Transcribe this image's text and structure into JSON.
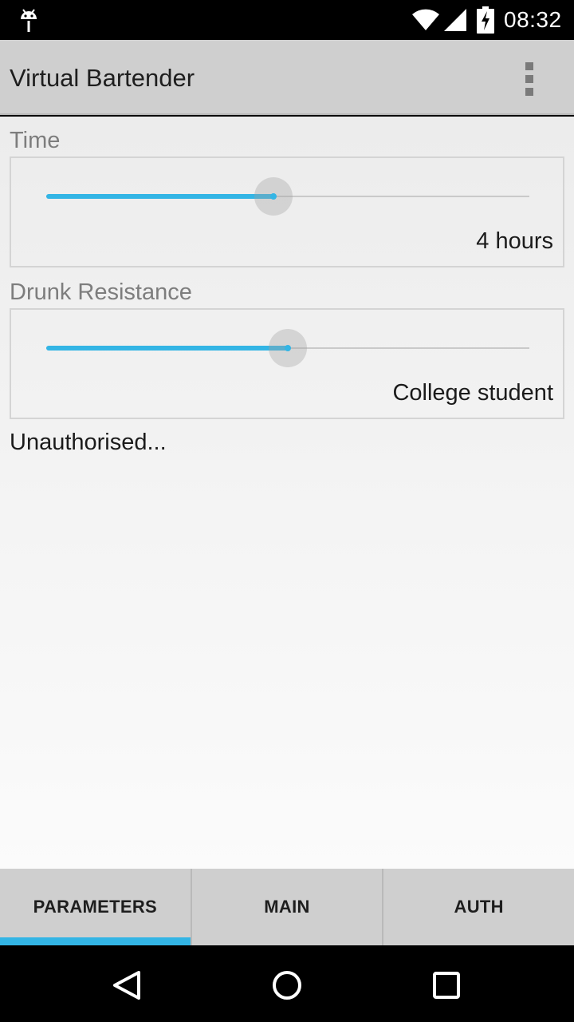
{
  "status_bar": {
    "time": "08:32",
    "icons": [
      "android-icon",
      "wifi-icon",
      "signal-icon",
      "battery-charging-icon"
    ]
  },
  "app_bar": {
    "title": "Virtual Bartender",
    "overflow_icon": "more-vert-icon"
  },
  "time_section": {
    "label": "Time",
    "slider_fraction": 0.47,
    "value": "4 hours"
  },
  "drunk_section": {
    "label": "Drunk Resistance",
    "slider_fraction": 0.5,
    "value": "College student"
  },
  "status": {
    "text": "Unauthorised..."
  },
  "tabs": [
    {
      "label": "PARAMETERS",
      "selected": true
    },
    {
      "label": "MAIN",
      "selected": false
    },
    {
      "label": "AUTH",
      "selected": false
    }
  ],
  "nav_bar": {
    "icons": [
      "back-icon",
      "home-icon",
      "recents-icon"
    ]
  },
  "colors": {
    "accent": "#33b5e5",
    "app_bar": "#cfcfcf"
  }
}
